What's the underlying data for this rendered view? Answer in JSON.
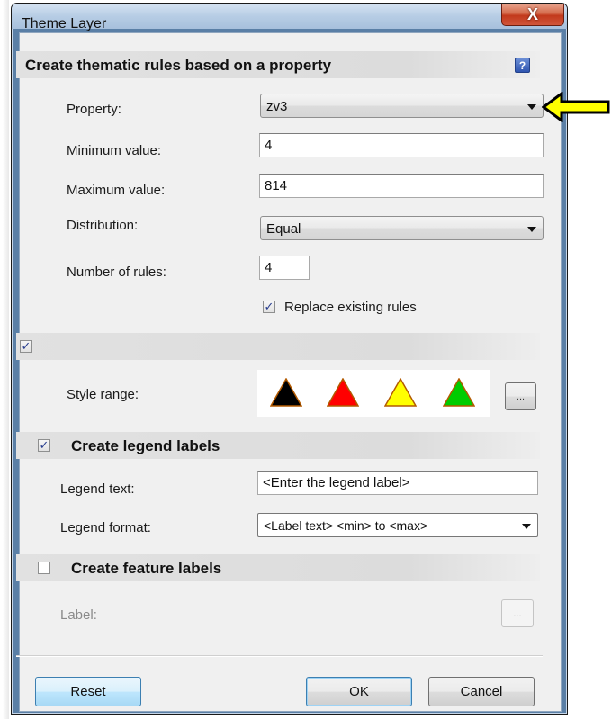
{
  "window": {
    "title": "Theme Layer",
    "close_glyph": "X"
  },
  "rules_section": {
    "title": "Create thematic rules based on a property",
    "help_glyph": "?",
    "property_label": "Property:",
    "property_value": "zv3",
    "minimum_label": "Minimum value:",
    "minimum_value": "4",
    "maximum_label": "Maximum value:",
    "maximum_value": "814",
    "distribution_label": "Distribution:",
    "distribution_value": "Equal",
    "number_of_rules_label": "Number of rules:",
    "number_of_rules_value": "4",
    "replace_label": "Replace existing rules",
    "replace_checked": true
  },
  "style_section": {
    "checked": true,
    "style_range_label": "Style range:",
    "triangle_colors": [
      "#000000",
      "#ff0000",
      "#ffff00",
      "#00cc00"
    ],
    "triangle_outline": "#b35a00",
    "ellipsis_label": "..."
  },
  "legend_section": {
    "title": "Create legend labels",
    "checked": true,
    "legend_text_label": "Legend text:",
    "legend_text_value": "<Enter the legend label>",
    "legend_format_label": "Legend format:",
    "legend_format_value": "<Label text> <min> to <max>"
  },
  "feature_section": {
    "title": "Create feature labels",
    "checked": false,
    "label_label": "Label:",
    "ellipsis_label": "..."
  },
  "footer": {
    "reset_label": "Reset",
    "ok_label": "OK",
    "cancel_label": "Cancel"
  },
  "annotation": {
    "arrow_color": "#ffff00",
    "arrow_icon": "left-arrow-icon"
  },
  "check_glyph": "✓"
}
